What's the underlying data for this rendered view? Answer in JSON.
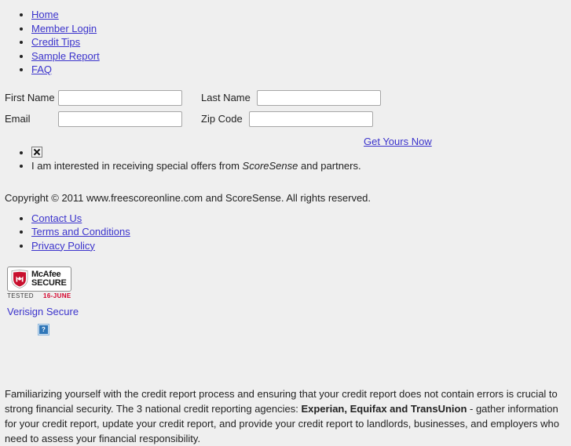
{
  "nav": {
    "items": [
      {
        "label": "Home",
        "name": "nav-item-home"
      },
      {
        "label": "Member Login",
        "name": "nav-item-member-login"
      },
      {
        "label": "Credit Tips",
        "name": "nav-item-credit-tips"
      },
      {
        "label": "Sample Report",
        "name": "nav-item-sample-report"
      },
      {
        "label": "FAQ",
        "name": "nav-item-faq"
      }
    ]
  },
  "form": {
    "first_name_label": "First Name",
    "first_name_value": "",
    "first_name_placeholder": "",
    "last_name_label": "Last Name",
    "last_name_value": "",
    "last_name_placeholder": "",
    "email_label": "Email",
    "email_value": "",
    "email_placeholder": "",
    "zip_label": "Zip Code",
    "zip_value": "",
    "zip_placeholder": "",
    "submit_label": "Get Yours Now"
  },
  "offers": {
    "checkbox_image_alt": "",
    "text_before": "I am interested in receiving special offers from ",
    "brand": "ScoreSense",
    "text_after": " and partners."
  },
  "copyright": "Copyright © 2011 www.freescoreonline.com and ScoreSense. All rights reserved.",
  "footer": {
    "items": [
      {
        "label": "Contact Us",
        "name": "footer-item-contact-us"
      },
      {
        "label": "Terms and Conditions",
        "name": "footer-item-terms-and-conditions"
      },
      {
        "label": "Privacy Policy",
        "name": "footer-item-privacy-policy"
      }
    ]
  },
  "badges": {
    "mcafee_top": "McAfee",
    "mcafee_bottom": "SECURE",
    "mcafee_shield_letter": "M",
    "tested_label": "TESTED",
    "tested_date": "16-JUNE",
    "verisign_label": "Verisign Secure",
    "broken_image_glyph": "?"
  },
  "bottom_paragraph": {
    "part1": "Familiarizing yourself with the credit report process and ensuring that your credit report does not contain errors is crucial to strong financial security. The 3 national credit reporting agencies: ",
    "bold": "Experian, Equifax and TransUnion",
    "part2": " - gather information for your credit report, update your credit report, and provide your credit report to landlords, businesses, and employers who need to assess your financial responsibility."
  },
  "colors": {
    "background": "#efefef",
    "link": "#3b33cc",
    "text": "#222222",
    "mcafee_red": "#c8102e",
    "tested_red": "#d4002a"
  }
}
